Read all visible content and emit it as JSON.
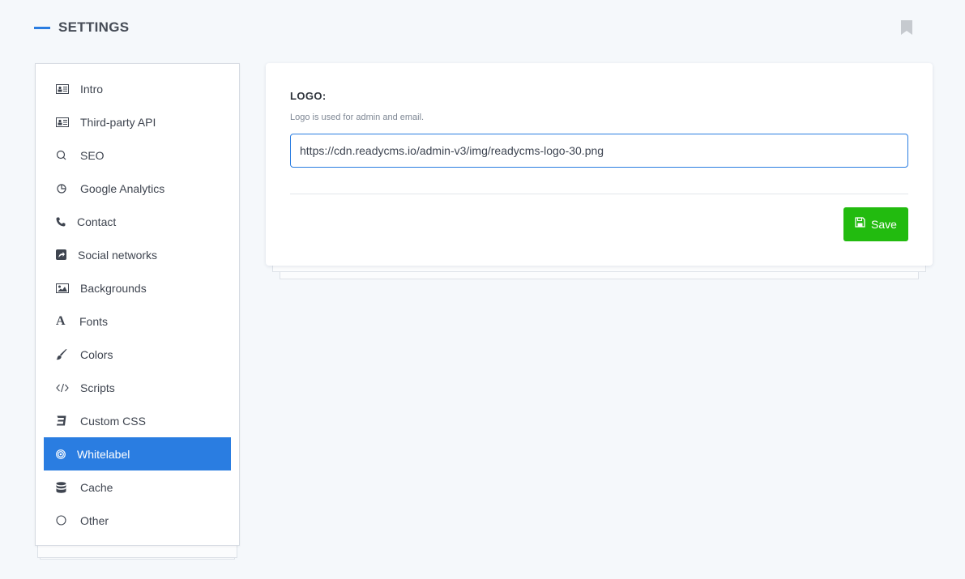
{
  "header": {
    "title": "SETTINGS",
    "bookmark_icon": "bookmark-icon"
  },
  "colors": {
    "accent": "#2a7de1",
    "save": "#22bb0f",
    "background": "#f5f8fb"
  },
  "sidebar": {
    "items": [
      {
        "label": "Intro",
        "icon": "id-card-icon",
        "active": false
      },
      {
        "label": "Third-party API",
        "icon": "id-card-icon",
        "active": false
      },
      {
        "label": "SEO",
        "icon": "search-icon",
        "active": false
      },
      {
        "label": "Google Analytics",
        "icon": "pie-chart-icon",
        "active": false
      },
      {
        "label": "Contact",
        "icon": "phone-icon",
        "active": false
      },
      {
        "label": "Social networks",
        "icon": "share-square-icon",
        "active": false
      },
      {
        "label": "Backgrounds",
        "icon": "image-icon",
        "active": false
      },
      {
        "label": "Fonts",
        "icon": "font-icon",
        "active": false
      },
      {
        "label": "Colors",
        "icon": "paint-brush-icon",
        "active": false
      },
      {
        "label": "Scripts",
        "icon": "code-icon",
        "active": false
      },
      {
        "label": "Custom CSS",
        "icon": "css3-icon",
        "active": false
      },
      {
        "label": "Whitelabel",
        "icon": "target-icon",
        "active": true
      },
      {
        "label": "Cache",
        "icon": "database-icon",
        "active": false
      },
      {
        "label": "Other",
        "icon": "circle-icon",
        "active": false
      }
    ]
  },
  "main": {
    "field_label": "LOGO:",
    "field_help": "Logo is used for admin and email.",
    "field_value": "https://cdn.readycms.io/admin-v3/img/readycms-logo-30.png",
    "save_label": "Save",
    "save_icon": "save-icon"
  }
}
